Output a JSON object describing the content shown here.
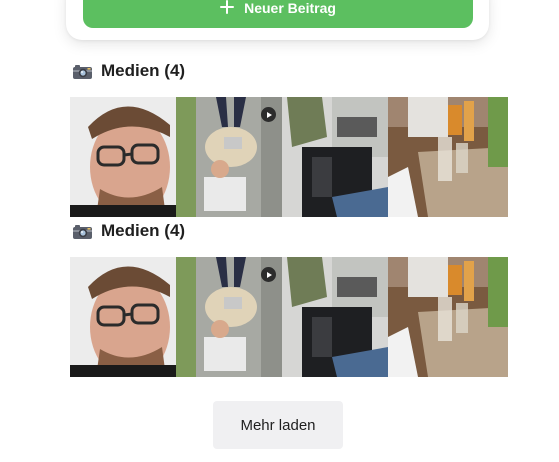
{
  "composer": {
    "new_post_label": "Neuer Beitrag",
    "icon": "plus-icon"
  },
  "media_sections": [
    {
      "title": "Medien (4)",
      "icon": "camera-icon",
      "items": [
        {
          "kind": "photo",
          "subject": "portrait-man-glasses"
        },
        {
          "kind": "video",
          "subject": "man-lying-on-newspaper"
        },
        {
          "kind": "photo",
          "subject": "person-seated-dark-chair"
        },
        {
          "kind": "photo",
          "subject": "table-with-beer-glasses"
        }
      ]
    },
    {
      "title": "Medien (4)",
      "icon": "camera-icon",
      "items": [
        {
          "kind": "photo",
          "subject": "portrait-man-glasses"
        },
        {
          "kind": "video",
          "subject": "man-lying-on-newspaper"
        },
        {
          "kind": "photo",
          "subject": "person-seated-dark-chair"
        },
        {
          "kind": "photo",
          "subject": "table-with-beer-glasses"
        }
      ]
    }
  ],
  "load_more_label": "Mehr laden",
  "colors": {
    "accent_green": "#5cbf60",
    "load_more_bg": "#f0f0f2",
    "text": "#1f1f1f"
  }
}
